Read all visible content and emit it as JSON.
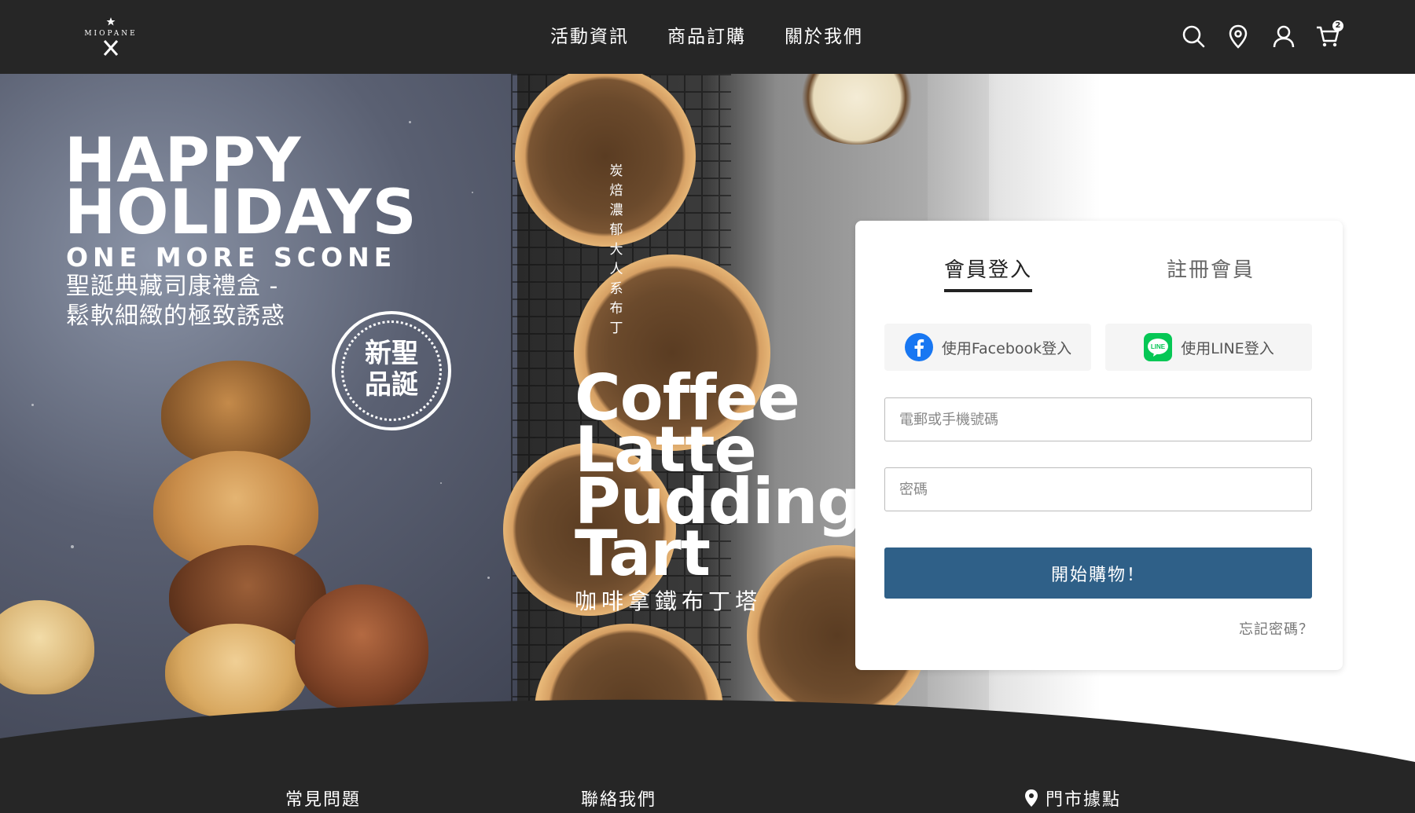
{
  "brand": {
    "logo_text": "MIOPANE"
  },
  "nav": {
    "items": [
      "活動資訊",
      "商品訂購",
      "關於我們"
    ]
  },
  "header_icons": {
    "search": "search-icon",
    "location": "map-pin-icon",
    "account": "user-icon",
    "cart": "cart-icon",
    "cart_count": "2"
  },
  "hero": {
    "left": {
      "title_line1": "HAPPY",
      "title_line2": "HOLIDAYS",
      "tagline": "ONE MORE SCONE",
      "subtitle_line1": "聖誕典藏司康禮盒 -",
      "subtitle_line2": "鬆軟細緻的極致誘惑",
      "badge_line1": "新聖",
      "badge_line2": "品誕"
    },
    "middle": {
      "vertical_text": "炭焙濃郁大人系布丁",
      "title_line1": "Coffee",
      "title_line2": "Latte",
      "title_line3": "Pudding",
      "title_line4": "Tart",
      "subtitle": "咖啡拿鐵布丁塔"
    }
  },
  "login": {
    "tab_login": "會員登入",
    "tab_register": "註冊會員",
    "facebook_label": "使用Facebook登入",
    "line_label": "使用LINE登入",
    "line_icon_text": "LINE",
    "account_placeholder": "電郵或手機號碼",
    "password_placeholder": "密碼",
    "submit_label": "開始購物！",
    "forgot_label": "忘記密碼？",
    "colors": {
      "submit": "#2f6088",
      "facebook": "#1877f2",
      "line": "#06c755"
    }
  },
  "footer": {
    "faq": "常見問題",
    "contact": "聯絡我們",
    "stores": "門市據點"
  },
  "colors": {
    "header_bg": "#262626",
    "footer_bg": "#262626"
  }
}
